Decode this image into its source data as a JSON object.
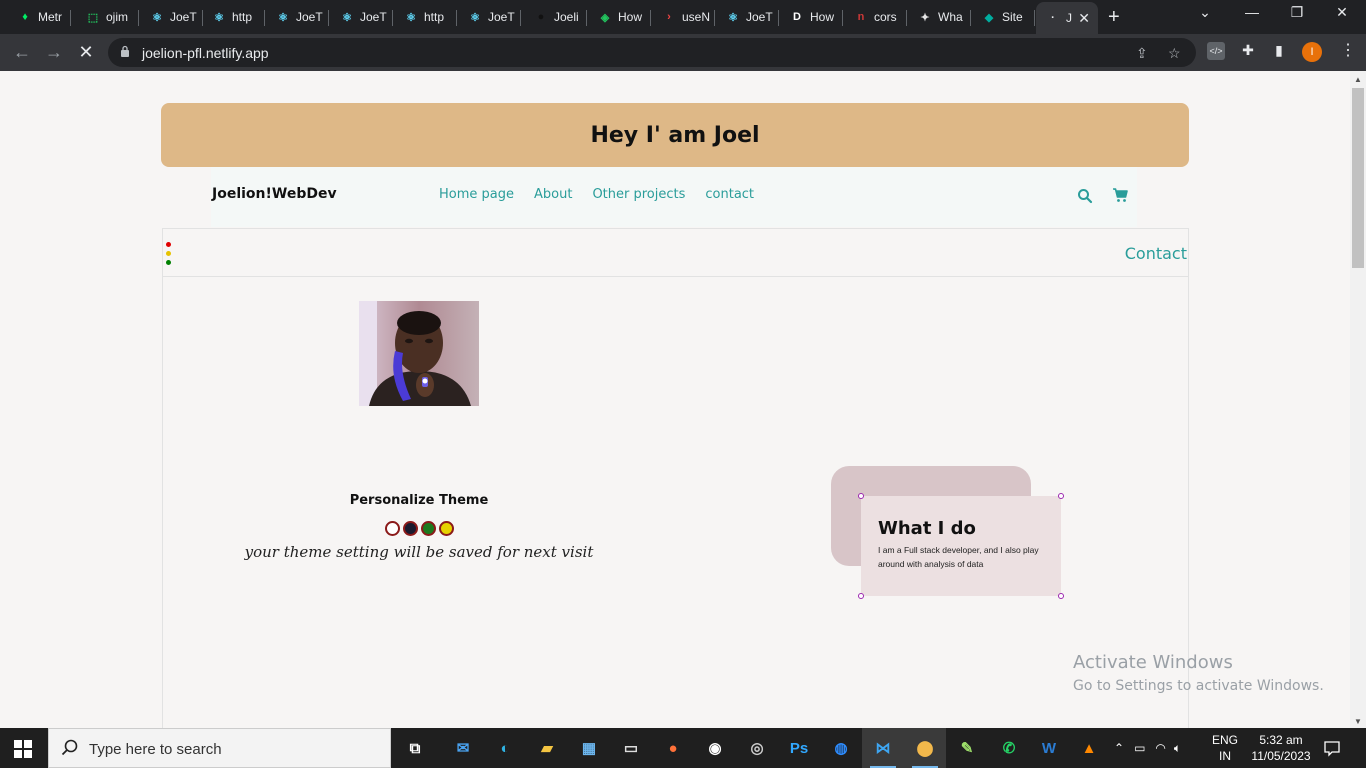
{
  "browser": {
    "tabs": [
      {
        "label": "Metr",
        "icon": "leaf-icon",
        "color": "#00ed64"
      },
      {
        "label": "ojim",
        "icon": "frame-icon",
        "color": "#22c55e"
      },
      {
        "label": "JoeT",
        "icon": "react-icon",
        "color": "#61dafb"
      },
      {
        "label": "http",
        "icon": "react-icon",
        "color": "#61dafb"
      },
      {
        "label": "JoeT",
        "icon": "react-icon",
        "color": "#61dafb"
      },
      {
        "label": "JoeT",
        "icon": "react-icon",
        "color": "#61dafb"
      },
      {
        "label": "http",
        "icon": "react-icon",
        "color": "#61dafb"
      },
      {
        "label": "JoeT",
        "icon": "react-icon",
        "color": "#61dafb"
      },
      {
        "label": "Joeli",
        "icon": "github-icon",
        "color": "#111111"
      },
      {
        "label": "How",
        "icon": "globe-icon",
        "color": "#22c55e"
      },
      {
        "label": "useN",
        "icon": "chevron-icon",
        "color": "#ef4444"
      },
      {
        "label": "JoeT",
        "icon": "react-icon",
        "color": "#61dafb"
      },
      {
        "label": "How",
        "icon": "dev-icon",
        "color": "#ffffff"
      },
      {
        "label": "cors",
        "icon": "npm-icon",
        "color": "#cb3837"
      },
      {
        "label": "Wha",
        "icon": "shield-icon",
        "color": "#e5e5e5"
      },
      {
        "label": "Site",
        "icon": "diamond-icon",
        "color": "#00ad9f"
      },
      {
        "label": "J",
        "icon": "dot-icon",
        "color": "#e8eaed",
        "active": true
      }
    ],
    "url": "joelion-pfl.netlify.app"
  },
  "page": {
    "hero_title": "Hey I' am Joel",
    "brand": "Joelion!WebDev",
    "nav_links": [
      "Home page",
      "About",
      "Other projects",
      "contact"
    ],
    "contact_link": "Contact",
    "theme_title": "Personalize Theme",
    "theme_swatches": [
      {
        "name": "light",
        "color": "#ffffff"
      },
      {
        "name": "dark",
        "color": "#1a1a2e"
      },
      {
        "name": "green",
        "color": "#1e7a1e"
      },
      {
        "name": "yellow",
        "color": "#e6d200"
      }
    ],
    "theme_note": "your theme setting will be saved for next visit",
    "card_title": "What I do",
    "card_text": "I am a Full stack developer, and I also play around with analysis of data",
    "status_dots": [
      "#e00000",
      "#e6c200",
      "#008000"
    ]
  },
  "watermark": {
    "line1": "Activate Windows",
    "line2": "Go to Settings to activate Windows."
  },
  "taskbar": {
    "search_placeholder": "Type here to search",
    "lang_line1": "ENG",
    "lang_line2": "IN",
    "time": "5:32 am",
    "date": "11/05/2023"
  }
}
